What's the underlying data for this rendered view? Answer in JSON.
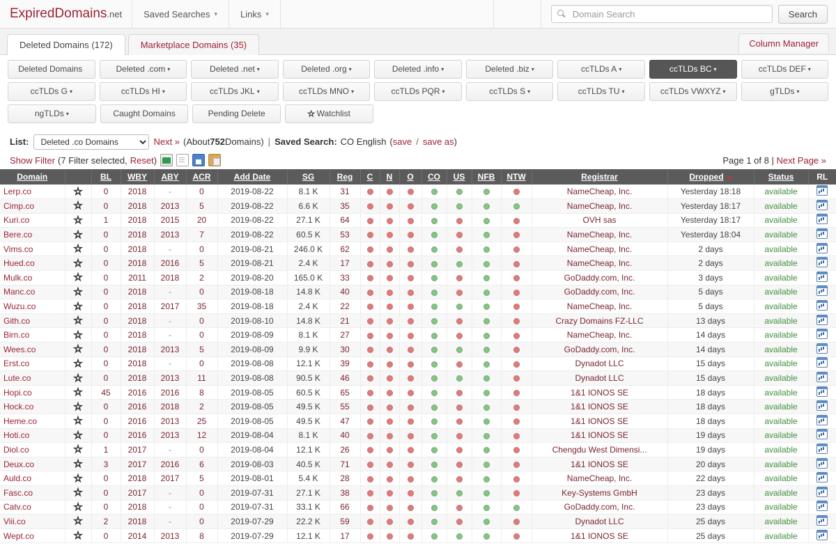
{
  "header": {
    "brand_main": "ExpiredDomains",
    "brand_tld": ".net",
    "nav": [
      {
        "label": "Saved Searches",
        "caret": "▾"
      },
      {
        "label": "Links",
        "caret": "▾"
      }
    ],
    "search": {
      "placeholder": "Domain Search",
      "value": "",
      "button_label": "Search",
      "icon": "search-icon"
    }
  },
  "tabs": [
    {
      "label": "Deleted Domains (172)",
      "active": true
    },
    {
      "label": "Marketplace Domains (35)",
      "active": false
    }
  ],
  "column_manager_label": "Column Manager",
  "button_rows": [
    [
      {
        "label": "Deleted Domains",
        "caret": "",
        "active": false
      },
      {
        "label": "Deleted .com",
        "caret": "▾",
        "active": false
      },
      {
        "label": "Deleted .net",
        "caret": "▾",
        "active": false
      },
      {
        "label": "Deleted .org",
        "caret": "▾",
        "active": false
      },
      {
        "label": "Deleted .info",
        "caret": "▾",
        "active": false
      },
      {
        "label": "Deleted .biz",
        "caret": "▾",
        "active": false
      },
      {
        "label": "ccTLDs A",
        "caret": "▾",
        "active": false
      },
      {
        "label": "ccTLDs BC",
        "caret": "▾",
        "active": true
      },
      {
        "label": "ccTLDs DEF",
        "caret": "▾",
        "active": false
      }
    ],
    [
      {
        "label": "ccTLDs G",
        "caret": "▾",
        "active": false
      },
      {
        "label": "ccTLDs HI",
        "caret": "▾",
        "active": false
      },
      {
        "label": "ccTLDs JKL",
        "caret": "▾",
        "active": false
      },
      {
        "label": "ccTLDs MNO",
        "caret": "▾",
        "active": false
      },
      {
        "label": "ccTLDs PQR",
        "caret": "▾",
        "active": false
      },
      {
        "label": "ccTLDs S",
        "caret": "▾",
        "active": false
      },
      {
        "label": "ccTLDs TU",
        "caret": "▾",
        "active": false
      },
      {
        "label": "ccTLDs VWXYZ",
        "caret": "▾",
        "active": false
      },
      {
        "label": "gTLDs",
        "caret": "▾",
        "active": false
      }
    ],
    [
      {
        "label": "ngTLDs",
        "caret": "▾",
        "active": false
      },
      {
        "label": "Caught Domains",
        "caret": "",
        "active": false
      },
      {
        "label": "Pending Delete",
        "caret": "",
        "active": false
      },
      {
        "label": "Watchlist",
        "caret": "",
        "star": "★",
        "active": false
      }
    ]
  ],
  "listbar": {
    "list_label": "List:",
    "list_selected": "Deleted .co Domains",
    "next_label": "Next »",
    "about_prefix": "(About ",
    "about_count": "752",
    "about_suffix": " Domains)",
    "pipe": "|",
    "saved_search_label": "Saved Search:",
    "saved_search_value": "CO English",
    "save_open": "(",
    "save_label": "save",
    "save_slash": "/",
    "saveas_label": "save as",
    "save_close": ")",
    "show_filter_label": "Show Filter",
    "filter_open": "(",
    "filter_count_text": "7 Filter selected,",
    "reset_label": "Reset",
    "filter_close": ")",
    "icons": [
      "excel-export-icon",
      "document-export-icon",
      "save-icon",
      "clipboard-icon"
    ],
    "page_text": "Page 1 of 8 | ",
    "next_page_label": "Next Page »"
  },
  "table": {
    "columns": [
      {
        "key": "domain",
        "label": "Domain",
        "sortable": true,
        "sorted": false
      },
      {
        "key": "star",
        "label": "",
        "sortable": false,
        "sorted": false
      },
      {
        "key": "bl",
        "label": "BL",
        "sortable": true,
        "sorted": false
      },
      {
        "key": "wby",
        "label": "WBY",
        "sortable": true,
        "sorted": false
      },
      {
        "key": "aby",
        "label": "ABY",
        "sortable": true,
        "sorted": false
      },
      {
        "key": "acr",
        "label": "ACR",
        "sortable": true,
        "sorted": false
      },
      {
        "key": "add_date",
        "label": "Add Date",
        "sortable": true,
        "sorted": false
      },
      {
        "key": "sg",
        "label": "SG",
        "sortable": true,
        "sorted": false
      },
      {
        "key": "reg",
        "label": "Reg",
        "sortable": true,
        "sorted": false
      },
      {
        "key": "c",
        "label": "C",
        "sortable": true,
        "sorted": false
      },
      {
        "key": "n",
        "label": "N",
        "sortable": true,
        "sorted": false
      },
      {
        "key": "o",
        "label": "O",
        "sortable": true,
        "sorted": false
      },
      {
        "key": "co",
        "label": "CO",
        "sortable": true,
        "sorted": false
      },
      {
        "key": "us",
        "label": "US",
        "sortable": true,
        "sorted": false
      },
      {
        "key": "nfb",
        "label": "NFB",
        "sortable": true,
        "sorted": false
      },
      {
        "key": "ntw",
        "label": "NTW",
        "sortable": true,
        "sorted": false
      },
      {
        "key": "registrar",
        "label": "Registrar",
        "sortable": true,
        "sorted": false
      },
      {
        "key": "dropped",
        "label": "Dropped",
        "sortable": true,
        "sorted": true
      },
      {
        "key": "status",
        "label": "Status",
        "sortable": true,
        "sorted": false
      },
      {
        "key": "rl",
        "label": "RL",
        "sortable": false,
        "sorted": false
      }
    ],
    "rows": [
      {
        "domain": "Lerp.co",
        "bl": "0",
        "wby": "2018",
        "aby": "-",
        "acr": "0",
        "add_date": "2019-08-22",
        "sg": "8.1 K",
        "reg": "31",
        "dots": [
          "r",
          "r",
          "r",
          "g",
          "g",
          "g",
          "r"
        ],
        "registrar": "NameCheap, Inc.",
        "dropped": "Yesterday 18:18",
        "status": "available"
      },
      {
        "domain": "Cimp.co",
        "bl": "0",
        "wby": "2018",
        "aby": "2013",
        "acr": "5",
        "add_date": "2019-08-22",
        "sg": "6.6 K",
        "reg": "35",
        "dots": [
          "r",
          "r",
          "r",
          "g",
          "g",
          "g",
          "g"
        ],
        "registrar": "NameCheap, Inc.",
        "dropped": "Yesterday 18:17",
        "status": "available"
      },
      {
        "domain": "Kuri.co",
        "bl": "1",
        "wby": "2018",
        "aby": "2015",
        "acr": "20",
        "add_date": "2019-08-22",
        "sg": "27.1 K",
        "reg": "64",
        "dots": [
          "r",
          "r",
          "r",
          "g",
          "r",
          "g",
          "r"
        ],
        "registrar": "OVH sas",
        "dropped": "Yesterday 18:17",
        "status": "available"
      },
      {
        "domain": "Bere.co",
        "bl": "0",
        "wby": "2018",
        "aby": "2013",
        "acr": "7",
        "add_date": "2019-08-22",
        "sg": "60.5 K",
        "reg": "53",
        "dots": [
          "r",
          "r",
          "r",
          "g",
          "r",
          "g",
          "r"
        ],
        "registrar": "NameCheap, Inc.",
        "dropped": "Yesterday 18:04",
        "status": "available"
      },
      {
        "domain": "Vims.co",
        "bl": "0",
        "wby": "2018",
        "aby": "-",
        "acr": "0",
        "add_date": "2019-08-21",
        "sg": "246.0 K",
        "reg": "62",
        "dots": [
          "r",
          "r",
          "r",
          "g",
          "r",
          "g",
          "r"
        ],
        "registrar": "NameCheap, Inc.",
        "dropped": "2 days",
        "status": "available"
      },
      {
        "domain": "Hued.co",
        "bl": "0",
        "wby": "2018",
        "aby": "2016",
        "acr": "5",
        "add_date": "2019-08-21",
        "sg": "2.4 K",
        "reg": "17",
        "dots": [
          "r",
          "r",
          "r",
          "g",
          "g",
          "g",
          "r"
        ],
        "registrar": "NameCheap, Inc.",
        "dropped": "2 days",
        "status": "available"
      },
      {
        "domain": "Mulk.co",
        "bl": "0",
        "wby": "2011",
        "aby": "2018",
        "acr": "2",
        "add_date": "2019-08-20",
        "sg": "165.0 K",
        "reg": "33",
        "dots": [
          "r",
          "r",
          "r",
          "g",
          "r",
          "g",
          "r"
        ],
        "registrar": "GoDaddy.com, Inc.",
        "dropped": "3 days",
        "status": "available"
      },
      {
        "domain": "Manc.co",
        "bl": "0",
        "wby": "2018",
        "aby": "-",
        "acr": "0",
        "add_date": "2019-08-18",
        "sg": "14.8 K",
        "reg": "40",
        "dots": [
          "r",
          "r",
          "r",
          "g",
          "r",
          "g",
          "r"
        ],
        "registrar": "GoDaddy.com, Inc.",
        "dropped": "5 days",
        "status": "available"
      },
      {
        "domain": "Wuzu.co",
        "bl": "0",
        "wby": "2018",
        "aby": "2017",
        "acr": "35",
        "add_date": "2019-08-18",
        "sg": "2.4 K",
        "reg": "22",
        "dots": [
          "r",
          "r",
          "r",
          "g",
          "g",
          "g",
          "r"
        ],
        "registrar": "NameCheap, Inc.",
        "dropped": "5 days",
        "status": "available"
      },
      {
        "domain": "Gith.co",
        "bl": "0",
        "wby": "2018",
        "aby": "-",
        "acr": "0",
        "add_date": "2019-08-10",
        "sg": "14.8 K",
        "reg": "21",
        "dots": [
          "r",
          "r",
          "r",
          "g",
          "r",
          "g",
          "r"
        ],
        "registrar": "Crazy Domains FZ-LLC",
        "dropped": "13 days",
        "status": "available"
      },
      {
        "domain": "Birn.co",
        "bl": "0",
        "wby": "2018",
        "aby": "-",
        "acr": "0",
        "add_date": "2019-08-09",
        "sg": "8.1 K",
        "reg": "27",
        "dots": [
          "r",
          "r",
          "r",
          "g",
          "r",
          "g",
          "r"
        ],
        "registrar": "NameCheap, Inc.",
        "dropped": "14 days",
        "status": "available"
      },
      {
        "domain": "Wees.co",
        "bl": "0",
        "wby": "2018",
        "aby": "2013",
        "acr": "5",
        "add_date": "2019-08-09",
        "sg": "9.9 K",
        "reg": "30",
        "dots": [
          "r",
          "r",
          "r",
          "g",
          "g",
          "g",
          "r"
        ],
        "registrar": "GoDaddy.com, Inc.",
        "dropped": "14 days",
        "status": "available"
      },
      {
        "domain": "Erst.co",
        "bl": "0",
        "wby": "2018",
        "aby": "-",
        "acr": "0",
        "add_date": "2019-08-08",
        "sg": "12.1 K",
        "reg": "39",
        "dots": [
          "r",
          "r",
          "r",
          "g",
          "r",
          "g",
          "r"
        ],
        "registrar": "Dynadot LLC",
        "dropped": "15 days",
        "status": "available"
      },
      {
        "domain": "Lute.co",
        "bl": "0",
        "wby": "2018",
        "aby": "2013",
        "acr": "11",
        "add_date": "2019-08-08",
        "sg": "90.5 K",
        "reg": "46",
        "dots": [
          "r",
          "r",
          "r",
          "g",
          "g",
          "g",
          "r"
        ],
        "registrar": "Dynadot LLC",
        "dropped": "15 days",
        "status": "available"
      },
      {
        "domain": "Hopi.co",
        "bl": "45",
        "wby": "2016",
        "aby": "2016",
        "acr": "8",
        "add_date": "2019-08-05",
        "sg": "60.5 K",
        "reg": "65",
        "dots": [
          "r",
          "r",
          "r",
          "g",
          "r",
          "g",
          "r"
        ],
        "registrar": "1&1 IONOS SE",
        "dropped": "18 days",
        "status": "available"
      },
      {
        "domain": "Hock.co",
        "bl": "0",
        "wby": "2016",
        "aby": "2018",
        "acr": "2",
        "add_date": "2019-08-05",
        "sg": "49.5 K",
        "reg": "55",
        "dots": [
          "r",
          "r",
          "r",
          "g",
          "r",
          "g",
          "r"
        ],
        "registrar": "1&1 IONOS SE",
        "dropped": "18 days",
        "status": "available"
      },
      {
        "domain": "Heme.co",
        "bl": "0",
        "wby": "2016",
        "aby": "2013",
        "acr": "25",
        "add_date": "2019-08-05",
        "sg": "49.5 K",
        "reg": "47",
        "dots": [
          "r",
          "r",
          "r",
          "g",
          "r",
          "g",
          "r"
        ],
        "registrar": "1&1 IONOS SE",
        "dropped": "18 days",
        "status": "available"
      },
      {
        "domain": "Hoti.co",
        "bl": "0",
        "wby": "2016",
        "aby": "2013",
        "acr": "12",
        "add_date": "2019-08-04",
        "sg": "8.1 K",
        "reg": "40",
        "dots": [
          "r",
          "r",
          "r",
          "g",
          "r",
          "g",
          "r"
        ],
        "registrar": "1&1 IONOS SE",
        "dropped": "19 days",
        "status": "available"
      },
      {
        "domain": "Diol.co",
        "bl": "1",
        "wby": "2017",
        "aby": "-",
        "acr": "0",
        "add_date": "2019-08-04",
        "sg": "12.1 K",
        "reg": "26",
        "dots": [
          "r",
          "r",
          "r",
          "g",
          "r",
          "g",
          "r"
        ],
        "registrar": "Chengdu West Dimensi...",
        "dropped": "19 days",
        "status": "available"
      },
      {
        "domain": "Deux.co",
        "bl": "3",
        "wby": "2017",
        "aby": "2016",
        "acr": "6",
        "add_date": "2019-08-03",
        "sg": "40.5 K",
        "reg": "71",
        "dots": [
          "r",
          "r",
          "r",
          "g",
          "r",
          "g",
          "r"
        ],
        "registrar": "1&1 IONOS SE",
        "dropped": "20 days",
        "status": "available"
      },
      {
        "domain": "Auld.co",
        "bl": "0",
        "wby": "2018",
        "aby": "2017",
        "acr": "5",
        "add_date": "2019-08-01",
        "sg": "5.4 K",
        "reg": "28",
        "dots": [
          "r",
          "r",
          "r",
          "g",
          "r",
          "g",
          "r"
        ],
        "registrar": "NameCheap, Inc.",
        "dropped": "22 days",
        "status": "available"
      },
      {
        "domain": "Fasc.co",
        "bl": "0",
        "wby": "2017",
        "aby": "-",
        "acr": "0",
        "add_date": "2019-07-31",
        "sg": "27.1 K",
        "reg": "38",
        "dots": [
          "r",
          "r",
          "r",
          "g",
          "g",
          "g",
          "r"
        ],
        "registrar": "Key-Systems GmbH",
        "dropped": "23 days",
        "status": "available"
      },
      {
        "domain": "Catv.co",
        "bl": "0",
        "wby": "2018",
        "aby": "-",
        "acr": "0",
        "add_date": "2019-07-31",
        "sg": "33.1 K",
        "reg": "66",
        "dots": [
          "r",
          "r",
          "r",
          "g",
          "r",
          "g",
          "g"
        ],
        "registrar": "GoDaddy.com, Inc.",
        "dropped": "23 days",
        "status": "available"
      },
      {
        "domain": "Viii.co",
        "bl": "2",
        "wby": "2018",
        "aby": "-",
        "acr": "0",
        "add_date": "2019-07-29",
        "sg": "22.2 K",
        "reg": "59",
        "dots": [
          "r",
          "r",
          "r",
          "g",
          "r",
          "g",
          "r"
        ],
        "registrar": "Dynadot LLC",
        "dropped": "25 days",
        "status": "available"
      },
      {
        "domain": "Wept.co",
        "bl": "0",
        "wby": "2014",
        "aby": "2013",
        "acr": "8",
        "add_date": "2019-07-29",
        "sg": "12.1 K",
        "reg": "17",
        "dots": [
          "r",
          "r",
          "r",
          "g",
          "g",
          "g",
          "r"
        ],
        "registrar": "1&1 IONOS SE",
        "dropped": "25 days",
        "status": "available"
      }
    ]
  },
  "colors": {
    "brand_red": "#9b2335",
    "link_red": "#9b2335",
    "status_green": "#3f8f3f",
    "header_gray": "#5b5b5b",
    "active_button": "#565656",
    "dot_red": "#de7c7c",
    "dot_green": "#86c486"
  }
}
